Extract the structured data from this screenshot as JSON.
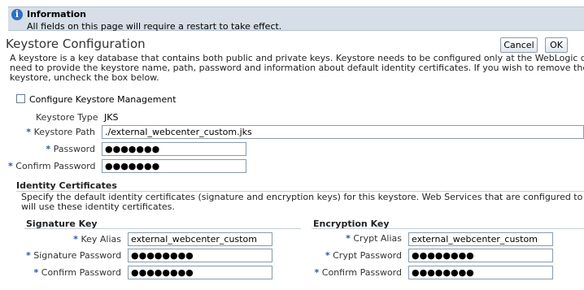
{
  "info": {
    "title": "Information",
    "message": "All fields on this page will require a restart to take effect."
  },
  "header": {
    "title": "Keystore Configuration",
    "cancel_label": "Cancel",
    "ok_label": "OK"
  },
  "description": {
    "line1": "A keystore is a key database that contains both public and private keys. Keystore needs to be configured only at the WebLogic domain level. You w",
    "line2": "need to provide the keystore name, path, password and information about default identity certificates. If you wish to remove the configuration of",
    "line3": "keystore, uncheck the box below."
  },
  "configure": {
    "label": "Configure Keystore Management",
    "checked": false
  },
  "keystore": {
    "type_label": "Keystore Type",
    "type_value": "JKS",
    "path_label": "Keystore Path",
    "path_value": "./external_webcenter_custom.jks",
    "password_label": "Password",
    "password_value": "●●●●●●●",
    "confirm_label": "Confirm Password",
    "confirm_value": "●●●●●●●"
  },
  "identity": {
    "heading": "Identity Certificates",
    "desc_line1": "Specify the default identity certificates (signature and encryption keys) for this keystore. Web Services that are configured to use this keystore",
    "desc_line2": "will use these identity certificates."
  },
  "signature": {
    "heading": "Signature Key",
    "alias_label": "Key Alias",
    "alias_value": "external_webcenter_custom",
    "password_label": "Signature Password",
    "password_value": "●●●●●●●●",
    "confirm_label": "Confirm Password",
    "confirm_value": "●●●●●●●●"
  },
  "encryption": {
    "heading": "Encryption Key",
    "alias_label": "Crypt Alias",
    "alias_value": "external_webcenter_custom",
    "password_label": "Crypt Password",
    "password_value": "●●●●●●●●",
    "confirm_label": "Confirm Password",
    "confirm_value": "●●●●●●●●"
  },
  "required_marker": "*",
  "colors": {
    "banner_bg": "#d6dfe7",
    "info_icon": "#2f6fc1",
    "required": "#2a57a8"
  }
}
